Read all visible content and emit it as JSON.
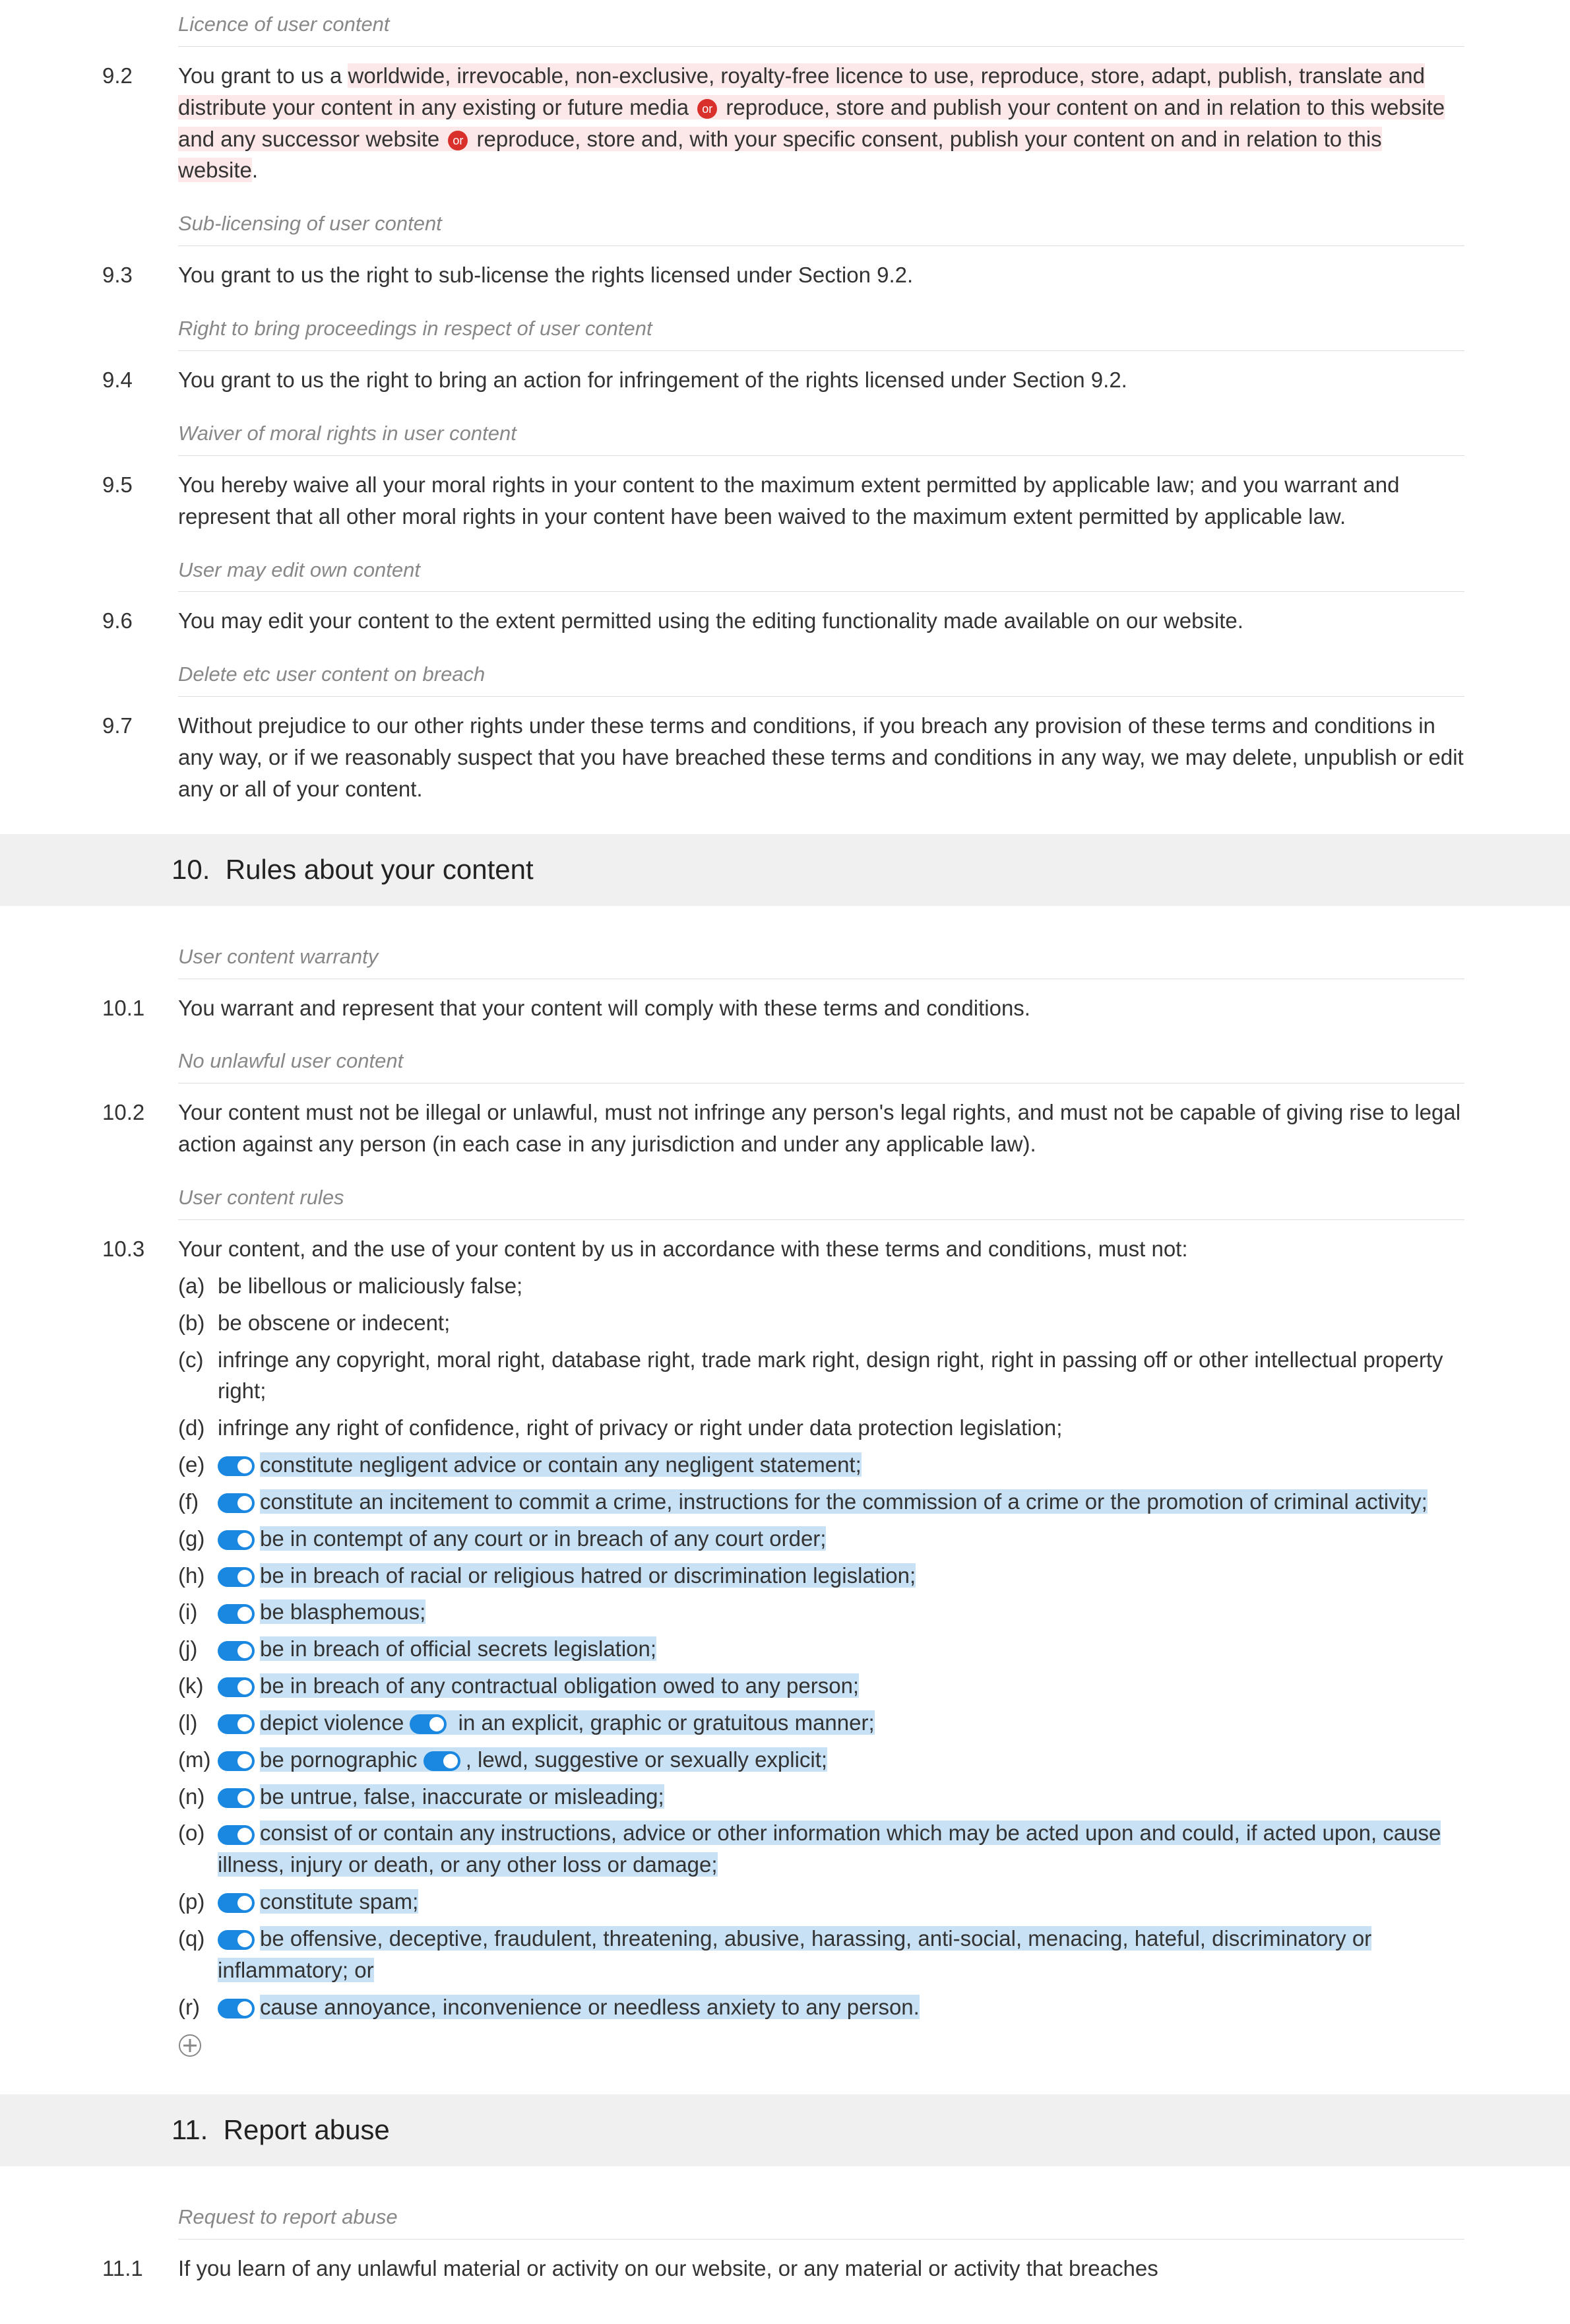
{
  "annotations": {
    "licence": "Licence of user content",
    "sublicensing": "Sub-licensing of user content",
    "right_proceedings": "Right to bring proceedings in respect of user content",
    "waiver_moral": "Waiver of moral rights in user content",
    "user_edit": "User may edit own content",
    "delete_breach": "Delete etc user content on breach",
    "user_warranty": "User content warranty",
    "no_unlawful": "No unlawful user content",
    "user_rules": "User content rules",
    "report_abuse": "Request to report abuse"
  },
  "s9": {
    "c2": {
      "num": "9.2",
      "pre": "You grant to us a ",
      "hl1": "worldwide, irrevocable, non-exclusive, royalty-free licence to use, reproduce, store, adapt, publish, translate and distribute your content in any existing or future media",
      "or1": "or",
      "hl2": " reproduce, store and publish your content on and in relation to this website and any successor website",
      "or2": "or",
      "hl3": " reproduce, store and, with your specific consent, publish your content on and in relation to this website",
      "post": "."
    },
    "c3": {
      "num": "9.3",
      "text": "You grant to us the right to sub-license the rights licensed under Section 9.2."
    },
    "c4": {
      "num": "9.4",
      "text": "You grant to us the right to bring an action for infringement of the rights licensed under Section 9.2."
    },
    "c5": {
      "num": "9.5",
      "text": "You hereby waive all your moral rights in your content to the maximum extent permitted by applicable law; and you warrant and represent that all other moral rights in your content have been waived to the maximum extent permitted by applicable law."
    },
    "c6": {
      "num": "9.6",
      "text": "You may edit your content to the extent permitted using the editing functionality made available on our website."
    },
    "c7": {
      "num": "9.7",
      "text": "Without prejudice to our other rights under these terms and conditions, if you breach any provision of these terms and conditions in any way, or if we reasonably suspect that you have breached these terms and conditions in any way, we may delete, unpublish or edit any or all of your content."
    }
  },
  "s10": {
    "num": "10.",
    "title": "Rules about your content",
    "c1": {
      "num": "10.1",
      "text": "You warrant and represent that your content will comply with these terms and conditions."
    },
    "c2": {
      "num": "10.2",
      "text": "Your content must not be illegal or unlawful, must not infringe any person's legal rights, and must not be capable of giving rise to legal action against any person (in each case in any jurisdiction and under any applicable law)."
    },
    "c3": {
      "num": "10.3",
      "intro": "Your content, and the use of your content by us in accordance with these terms and conditions, must not:",
      "items": {
        "a": {
          "letter": "(a)",
          "text": "be libellous or maliciously false;"
        },
        "b": {
          "letter": "(b)",
          "text": "be obscene or indecent;"
        },
        "c": {
          "letter": "(c)",
          "text": "infringe any copyright, moral right, database right, trade mark right, design right, right in passing off or other intellectual property right;"
        },
        "d": {
          "letter": "(d)",
          "text": "infringe any right of confidence, right of privacy or right under data protection legislation;"
        },
        "e": {
          "letter": "(e)",
          "text": "constitute negligent advice or contain any negligent statement;"
        },
        "f": {
          "letter": "(f)",
          "text": "constitute an incitement to commit a crime, instructions for the commission of a crime or the promotion of criminal activity;"
        },
        "g": {
          "letter": "(g)",
          "text": "be in contempt of any court or in breach of any court order;"
        },
        "h": {
          "letter": "(h)",
          "text": "be in breach of racial or religious hatred or discrimination legislation;"
        },
        "i": {
          "letter": "(i)",
          "text": "be blasphemous;"
        },
        "j": {
          "letter": "(j)",
          "text": "be in breach of official secrets legislation;"
        },
        "k": {
          "letter": "(k)",
          "text": "be in breach of any contractual obligation owed to any person;"
        },
        "l": {
          "letter": "(l)",
          "t1": "depict violence",
          "t2": " in an explicit, graphic or gratuitous manner;"
        },
        "m": {
          "letter": "(m)",
          "t1": "be pornographic",
          "t2": ", lewd, suggestive or sexually explicit;"
        },
        "n": {
          "letter": "(n)",
          "text": "be untrue, false, inaccurate or misleading;"
        },
        "o": {
          "letter": "(o)",
          "text": "consist of or contain any instructions, advice or other information which may be acted upon and could, if acted upon, cause illness, injury or death, or any other loss or damage;"
        },
        "p": {
          "letter": "(p)",
          "text": "constitute spam;"
        },
        "q": {
          "letter": "(q)",
          "text": "be offensive, deceptive, fraudulent, threatening, abusive, harassing, anti-social, menacing, hateful, discriminatory or inflammatory; or"
        },
        "r": {
          "letter": "(r)",
          "text": "cause annoyance, inconvenience or needless anxiety to any person."
        }
      }
    }
  },
  "s11": {
    "num": "11.",
    "title": "Report abuse",
    "c1": {
      "num": "11.1",
      "text": "If you learn of any unlawful material or activity on our website, or any material or activity that breaches"
    }
  }
}
